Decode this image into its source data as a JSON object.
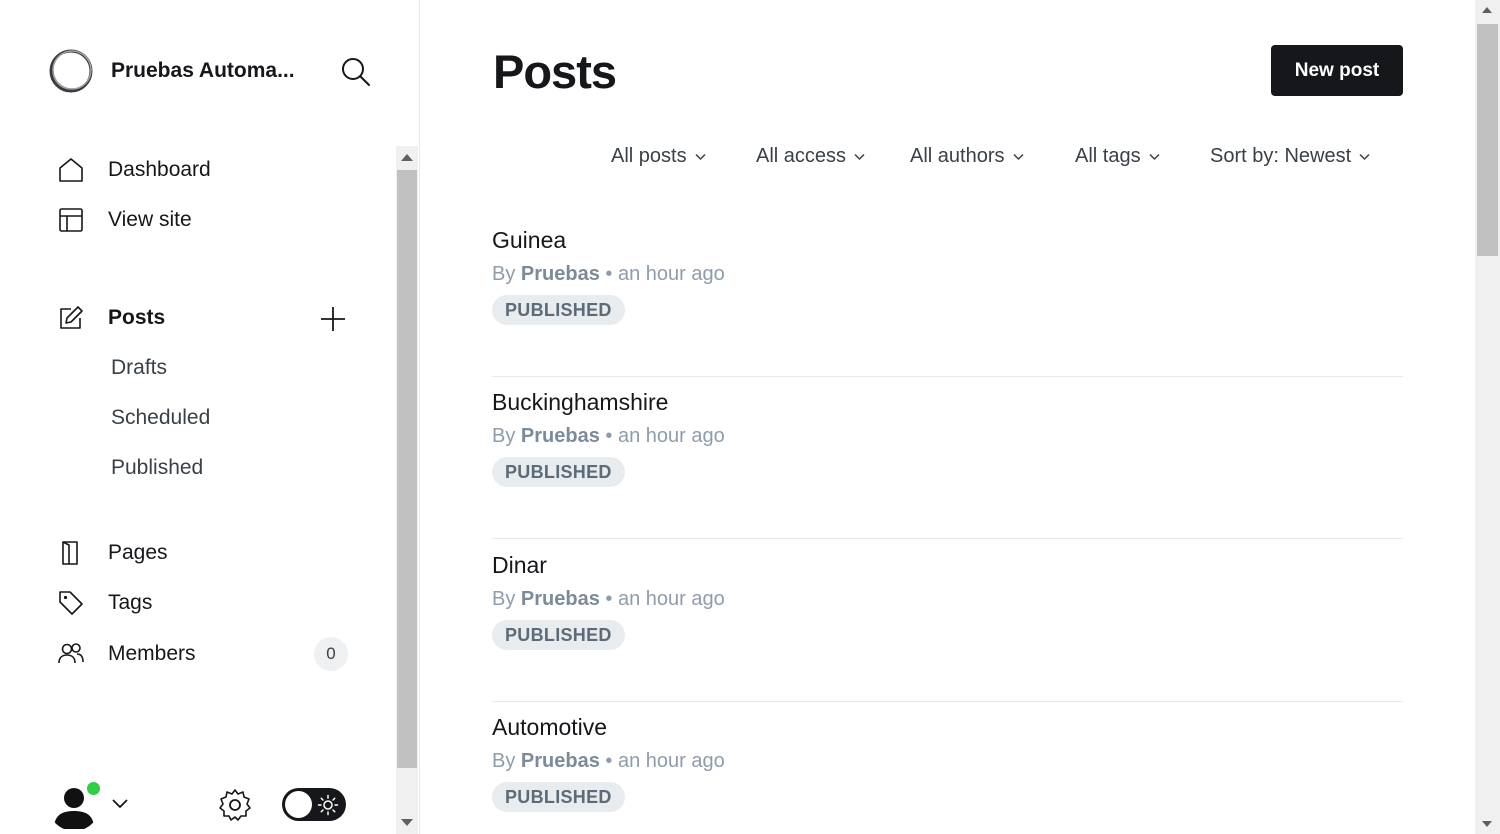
{
  "sidebar": {
    "site_title": "Pruebas Automa...",
    "nav": {
      "dashboard": "Dashboard",
      "view_site": "View site",
      "posts": "Posts",
      "drafts": "Drafts",
      "scheduled": "Scheduled",
      "published": "Published",
      "pages": "Pages",
      "tags": "Tags",
      "members": "Members",
      "members_count": "0"
    },
    "icons": {
      "dashboard": "home-icon",
      "view_site": "layout-icon",
      "posts": "edit-icon",
      "pages": "page-icon",
      "tags": "tag-icon",
      "members": "users-icon"
    }
  },
  "main": {
    "title": "Posts",
    "new_post_label": "New post",
    "filters": {
      "type": "All posts",
      "access": "All access",
      "authors": "All authors",
      "tags": "All tags",
      "sort": "Sort by: Newest"
    },
    "posts": [
      {
        "title": "Guinea",
        "by": "By",
        "author": "Pruebas",
        "time": "• an hour ago",
        "status": "PUBLISHED"
      },
      {
        "title": "Buckinghamshire",
        "by": "By",
        "author": "Pruebas",
        "time": "• an hour ago",
        "status": "PUBLISHED"
      },
      {
        "title": "Dinar",
        "by": "By",
        "author": "Pruebas",
        "time": "• an hour ago",
        "status": "PUBLISHED"
      },
      {
        "title": "Automotive",
        "by": "By",
        "author": "Pruebas",
        "time": "• an hour ago",
        "status": "PUBLISHED"
      }
    ]
  },
  "colors": {
    "accent": "#15171a",
    "online": "#30cf43",
    "muted": "#8e9cac"
  }
}
